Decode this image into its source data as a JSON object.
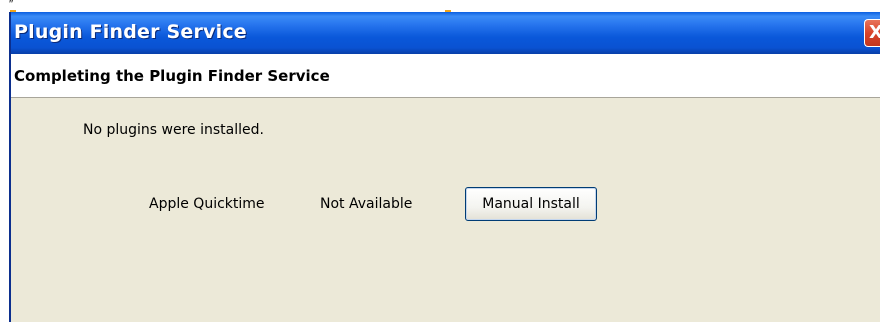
{
  "window": {
    "title": "Plugin Finder Service",
    "close_symbol": "X",
    "close_icon": "close-icon"
  },
  "header": {
    "title": "Completing the Plugin Finder Service"
  },
  "content": {
    "status_message": "No plugins were installed.",
    "plugins": [
      {
        "name": "Apple Quicktime",
        "status": "Not Available",
        "action_label": "Manual Install"
      }
    ]
  },
  "top_mark": "″",
  "colors": {
    "titlebar": "#0a58da",
    "content_background": "#ece9d8",
    "close_button": "#d9442a",
    "handle": "#f2a418"
  }
}
